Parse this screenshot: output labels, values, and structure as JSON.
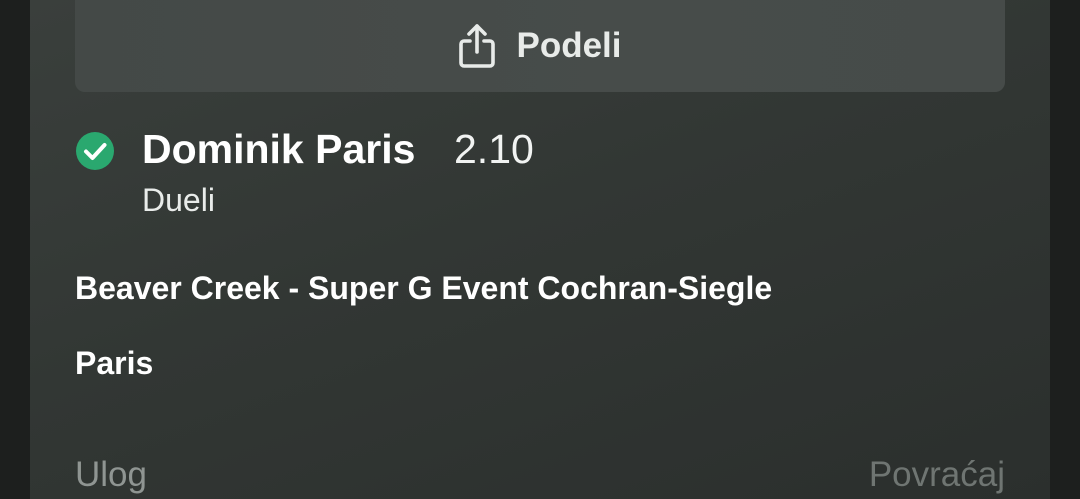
{
  "share": {
    "label": "Podeli",
    "icon": "share-icon"
  },
  "selection": {
    "status_icon": "check-circle-icon",
    "status_color": "#2aa86f",
    "name": "Dominik Paris",
    "odds": "2.10",
    "market": "Dueli"
  },
  "event": {
    "name": "Beaver Creek - Super G Event Cochran-Siegle",
    "pick": "Paris"
  },
  "footer": {
    "stake_label": "Ulog",
    "return_label": "Povraćaj"
  }
}
